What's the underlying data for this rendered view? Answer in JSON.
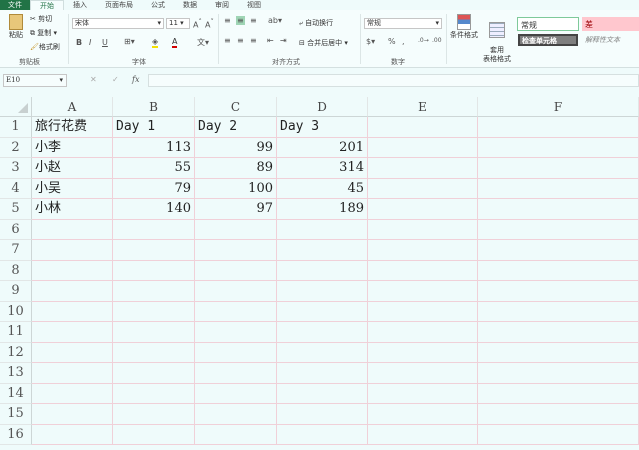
{
  "tabs": [
    "文件",
    "开始",
    "插入",
    "页面布局",
    "公式",
    "数据",
    "审阅",
    "视图"
  ],
  "clipboard": {
    "paste": "粘贴",
    "cut": "剪切",
    "copy": "复制",
    "format_painter": "格式刷",
    "group": "剪贴板"
  },
  "font": {
    "name": "宋体",
    "size": "11",
    "bold": "B",
    "italic": "I",
    "underline": "U",
    "group": "字体"
  },
  "alignment": {
    "wrap": "自动换行",
    "merge": "合并后居中",
    "group": "对齐方式"
  },
  "number": {
    "format": "常规",
    "percent": "%",
    "comma": ",",
    "group": "数字"
  },
  "styles": {
    "conditional": "条件格式",
    "table": "套用\n表格格式",
    "normal": "常规",
    "bad": "差",
    "check_cell": "检查单元格",
    "explanatory": "解释性文本"
  },
  "formula_bar": {
    "name_box": "E10",
    "fx": "fx",
    "value": ""
  },
  "columns": [
    "A",
    "B",
    "C",
    "D",
    "E",
    "F"
  ],
  "rows": [
    "1",
    "2",
    "3",
    "4",
    "5",
    "6",
    "7",
    "8",
    "9",
    "10",
    "11",
    "12",
    "13",
    "14",
    "15",
    "16"
  ],
  "cells": [
    [
      "旅行花费",
      "Day 1",
      "Day 2",
      "Day 3"
    ],
    [
      "小李",
      "113",
      "99",
      "201"
    ],
    [
      "小赵",
      "55",
      "89",
      "314"
    ],
    [
      "小吴",
      "79",
      "100",
      "45"
    ],
    [
      "小林",
      "140",
      "97",
      "189"
    ]
  ]
}
